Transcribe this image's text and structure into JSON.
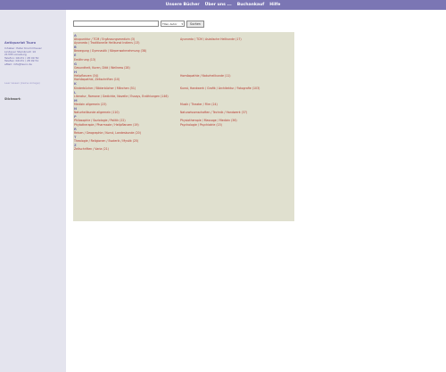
{
  "nav": [
    "Unsere Bücher",
    "Über uns ...",
    "Buchankauf",
    "Hilfe"
  ],
  "sidebar": {
    "name": "Antiquariat Tsuro",
    "address": [
      "Inhaber: Peter Krummheuer",
      "Lindauer Steinbruch 10",
      "21335 Lüneburg",
      "Telefon: 04131 / 28 09 50",
      "Telefax: 04131 / 28 09 51",
      "eMail: info@tsuro.de"
    ],
    "link": "Leer lassen (keine Anlage)",
    "keywords_label": "Stichwort:"
  },
  "search": {
    "value": "",
    "select_value": "Titel, Autor",
    "button": "Suchen"
  },
  "groups": [
    {
      "letter": "A",
      "rows": [
        [
          "Akupunktur / TCM / Ergänzungsmedizin (3)",
          "Ayurveda / TCM / Asiatische Heilkunde (17)"
        ],
        [
          "Ayurveda / Traditionelle Heilkunst Indiens (13)",
          ""
        ]
      ]
    },
    {
      "letter": "B",
      "rows": [
        [
          "Bewegung / Gymnastik / Körperwahrnehmung (38)",
          ""
        ]
      ]
    },
    {
      "letter": "E",
      "rows": [
        [
          "Ernährung (13)",
          ""
        ]
      ]
    },
    {
      "letter": "G",
      "rows": [
        [
          "Gesundheit, Kuren, Diät / Wellness (28)",
          ""
        ]
      ]
    },
    {
      "letter": "H",
      "rows": [
        [
          "Heilpflanzen (34)",
          "Homöopathie / Naturheilkunde (11)"
        ],
        [
          "Homöopathie, Zeitschriften (10)",
          ""
        ]
      ]
    },
    {
      "letter": "K",
      "rows": [
        [
          "Kinderbücher / Bilderbücher / Märchen (51)",
          "Kunst, Handwerk / Grafik / Architektur / Fotografie (103)"
        ]
      ]
    },
    {
      "letter": "L",
      "rows": [
        [
          "Literatur, Romane / Gedichte, Novelle / Essays, Erzählungen (146)",
          ""
        ]
      ]
    },
    {
      "letter": "M",
      "rows": [
        [
          "Medizin allgemein (23)",
          "Musik / Theater / Film (24)"
        ]
      ]
    },
    {
      "letter": "N",
      "rows": [
        [
          "Naturheilkunde allgemein (110)",
          "Naturwissenschaften / Technik / Handwerk (37)"
        ]
      ]
    },
    {
      "letter": "P",
      "rows": [
        [
          "Philosophie / Soziologie / Politik (22)",
          "Physiotherapie / Massage / Medizin (36)"
        ],
        [
          "Phytotherapie / Pharmazie / Heilpflanzen (19)",
          "Psychologie / Psychiatrie (15)"
        ]
      ]
    },
    {
      "letter": "R",
      "rows": [
        [
          "Reisen / Geographie / Kunst, Landeskunde (20)",
          ""
        ]
      ]
    },
    {
      "letter": "T",
      "rows": [
        [
          "Theologie / Religionen / Esoterik / Mystik (25)",
          ""
        ]
      ]
    },
    {
      "letter": "Z",
      "rows": [
        [
          "Zeitschriften / Varia (21)",
          ""
        ]
      ]
    }
  ]
}
